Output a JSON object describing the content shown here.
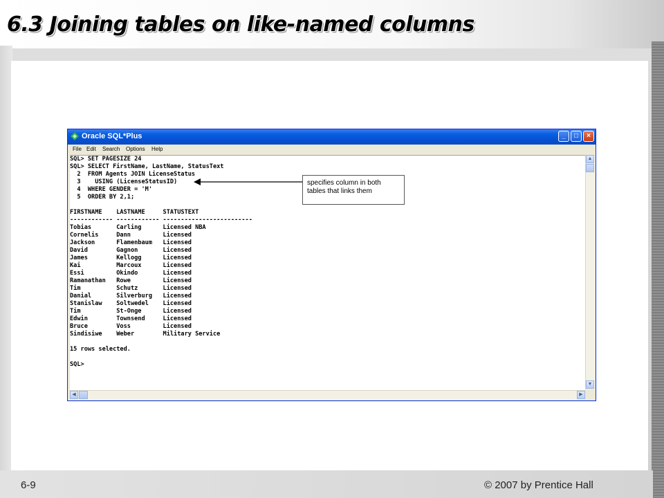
{
  "slide": {
    "title": "6.3 Joining tables on like-named columns",
    "footer_left": "6-9",
    "footer_right": "© 2007 by Prentice Hall"
  },
  "window": {
    "title": "Oracle SQL*Plus",
    "controls": [
      "minimize",
      "maximize",
      "close"
    ],
    "icon": "oracle-app-icon"
  },
  "menu": {
    "items": [
      "File",
      "Edit",
      "Search",
      "Options",
      "Help"
    ]
  },
  "console": {
    "lines": [
      "SQL> SET PAGESIZE 24",
      "SQL> SELECT FirstName, LastName, StatusText",
      "  2  FROM Agents JOIN LicenseStatus",
      "  3    USING (LicenseStatusID)",
      "  4  WHERE GENDER = 'M'",
      "  5  ORDER BY 2,1;",
      "",
      "FIRSTNAME    LASTNAME     STATUSTEXT",
      "------------ ------------ -------------------------",
      "Tobias       Carling      Licensed NBA",
      "Cornelis     Dann         Licensed",
      "Jackson      Flamenbaum   Licensed",
      "David        Gagnon       Licensed",
      "James        Kellogg      Licensed",
      "Kai          Marcoux      Licensed",
      "Essi         Okindo       Licensed",
      "Ramanathan   Rowe         Licensed",
      "Tim          Schutz       Licensed",
      "Danial       Silverburg   Licensed",
      "Stanislaw    Soltwedel    Licensed",
      "Tim          St-Onge      Licensed",
      "Edwin        Townsend     Licensed",
      "Bruce        Voss         Licensed",
      "Sindisiwe    Weber        Military Service",
      "",
      "15 rows selected.",
      "",
      "SQL>"
    ]
  },
  "callout": {
    "text": "specifies column in both tables that links them"
  },
  "colors": {
    "titlebar": "#0550d4",
    "window_frame": "#ece9d8",
    "close_button": "#c53a16"
  }
}
